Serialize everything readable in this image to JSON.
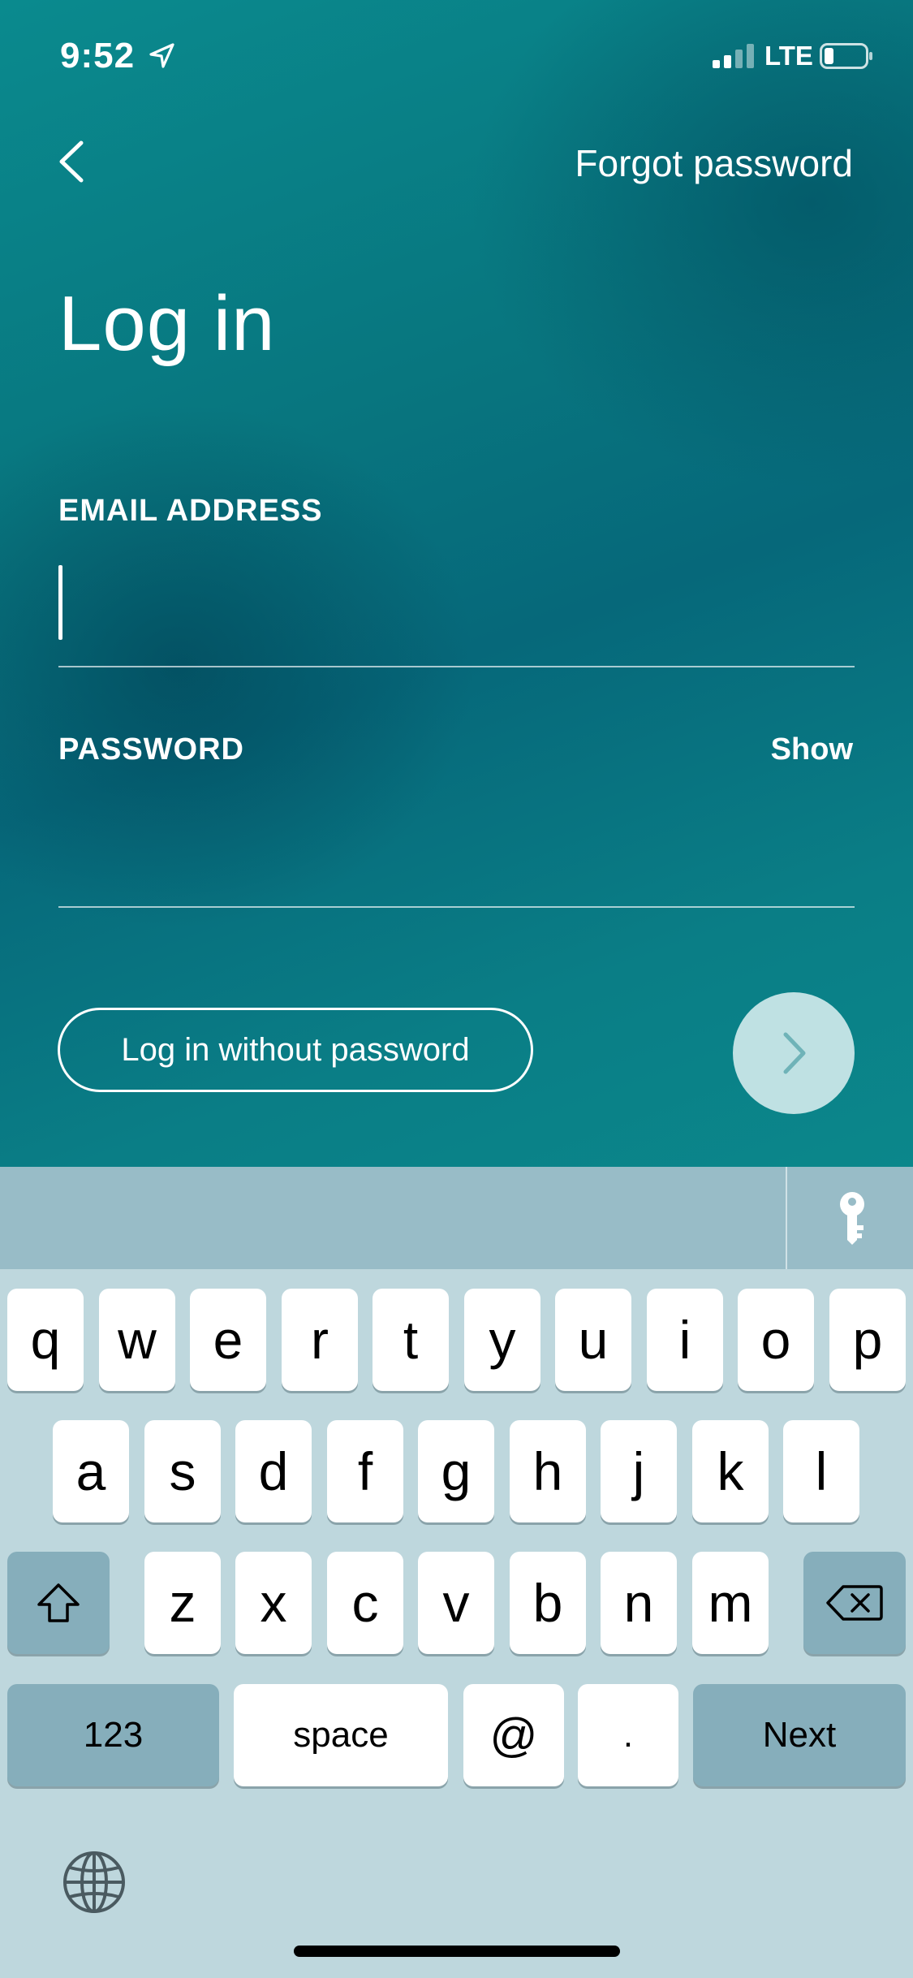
{
  "status_bar": {
    "time": "9:52",
    "network": "LTE"
  },
  "header": {
    "forgot_label": "Forgot password"
  },
  "title": "Log in",
  "email": {
    "label": "EMAIL ADDRESS",
    "value": ""
  },
  "password": {
    "label": "PASSWORD",
    "show_label": "Show",
    "value": ""
  },
  "buttons": {
    "no_password_label": "Log in without password"
  },
  "keyboard": {
    "row1": [
      "q",
      "w",
      "e",
      "r",
      "t",
      "y",
      "u",
      "i",
      "o",
      "p"
    ],
    "row2": [
      "a",
      "s",
      "d",
      "f",
      "g",
      "h",
      "j",
      "k",
      "l"
    ],
    "row3": [
      "z",
      "x",
      "c",
      "v",
      "b",
      "n",
      "m"
    ],
    "numbers_label": "123",
    "space_label": "space",
    "at_label": "@",
    "dot_label": ".",
    "next_label": "Next"
  },
  "colors": {
    "accent": "#08767f",
    "keyboard_bg": "#bed7dd",
    "toolbar_bg": "#98bcc7"
  },
  "icons": [
    "back-chevron-icon",
    "location-arrow-icon",
    "signal-icon",
    "battery-icon",
    "key-icon",
    "shift-icon",
    "backspace-icon",
    "globe-icon",
    "chevron-right-icon"
  ]
}
